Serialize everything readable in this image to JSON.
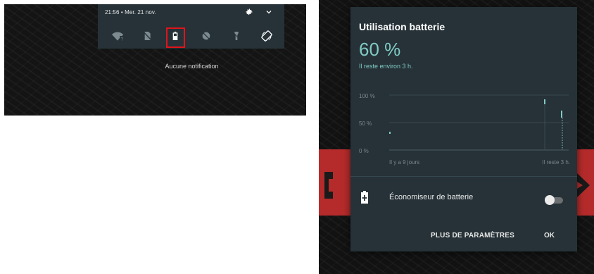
{
  "notification_shade": {
    "status_time": "21:56 • Mer. 21 nov.",
    "icons": {
      "settings": "gear-icon",
      "expand": "chevron-down-icon"
    },
    "tiles": [
      {
        "name": "wifi-tile",
        "icon": "wifi-question-icon"
      },
      {
        "name": "mobile-data-tile",
        "icon": "no-sim-icon"
      },
      {
        "name": "battery-tile",
        "icon": "battery-icon",
        "highlighted": true
      },
      {
        "name": "do-not-disturb-tile",
        "icon": "dnd-off-icon"
      },
      {
        "name": "flashlight-tile",
        "icon": "flashlight-icon"
      },
      {
        "name": "auto-rotate-tile",
        "icon": "rotate-icon"
      }
    ],
    "empty_text": "Aucune notification",
    "highlight_color": "#e0141b"
  },
  "battery_dialog": {
    "title": "Utilisation batterie",
    "percent": "60 %",
    "remaining": "Il reste environ 3 h.",
    "accent_color": "#80cbc4",
    "saver_label": "Économiseur de batterie",
    "saver_enabled": false,
    "more_button": "PLUS DE PARAMÈTRES",
    "ok_button": "OK"
  },
  "chart_data": {
    "type": "line",
    "y_ticks": [
      "100 %",
      "50 %",
      "0 %"
    ],
    "x_labels": [
      "Il y a 9 jours",
      "Il reste 3 h."
    ],
    "ylim": [
      0,
      100
    ],
    "grid": true,
    "series": [
      {
        "values_x": [
          0.0
        ],
        "values_y": [
          30
        ]
      },
      {
        "values_x": [
          0.95
        ],
        "values_y": [
          90
        ]
      },
      {
        "values_x": [
          1.0
        ],
        "values_y": [
          70
        ]
      }
    ]
  }
}
